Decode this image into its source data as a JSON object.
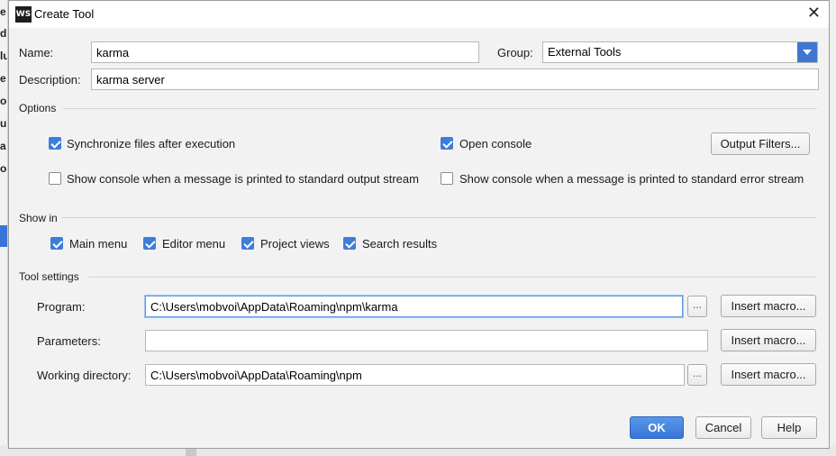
{
  "background": {
    "left_chars": [
      "e",
      "d",
      "lu",
      "e",
      "oi",
      "u",
      "a",
      "o"
    ]
  },
  "dialog": {
    "app_icon": "WS",
    "title": "Create Tool",
    "close_glyph": "✕"
  },
  "fields": {
    "name_label": "Name:",
    "name_value": "karma",
    "group_label": "Group:",
    "group_value": "External Tools",
    "description_label": "Description:",
    "description_value": "karma server"
  },
  "options": {
    "title": "Options",
    "sync_files": {
      "label": "Synchronize files after execution",
      "checked": true
    },
    "open_console": {
      "label": "Open console",
      "checked": true
    },
    "output_filters_button": "Output Filters...",
    "show_console_stdout": {
      "label": "Show console when a message is printed to standard output stream",
      "checked": false
    },
    "show_console_stderr": {
      "label": "Show console when a message is printed to standard error stream",
      "checked": false
    }
  },
  "show_in": {
    "title": "Show in",
    "main_menu": {
      "label": "Main menu",
      "checked": true
    },
    "editor_menu": {
      "label": "Editor menu",
      "checked": true
    },
    "project_views": {
      "label": "Project views",
      "checked": true
    },
    "search_results": {
      "label": "Search results",
      "checked": true
    }
  },
  "tool_settings": {
    "title": "Tool settings",
    "program_label": "Program:",
    "program_value": "C:\\Users\\mobvoi\\AppData\\Roaming\\npm\\karma",
    "parameters_label": "Parameters:",
    "parameters_value": "",
    "working_dir_label": "Working directory:",
    "working_dir_value": "C:\\Users\\mobvoi\\AppData\\Roaming\\npm",
    "browse_label": "...",
    "insert_macro_label": "Insert macro..."
  },
  "buttons": {
    "ok": "OK",
    "cancel": "Cancel",
    "help": "Help"
  },
  "colors": {
    "accent": "#3d7ddb",
    "focus_border": "#5b9be6"
  }
}
